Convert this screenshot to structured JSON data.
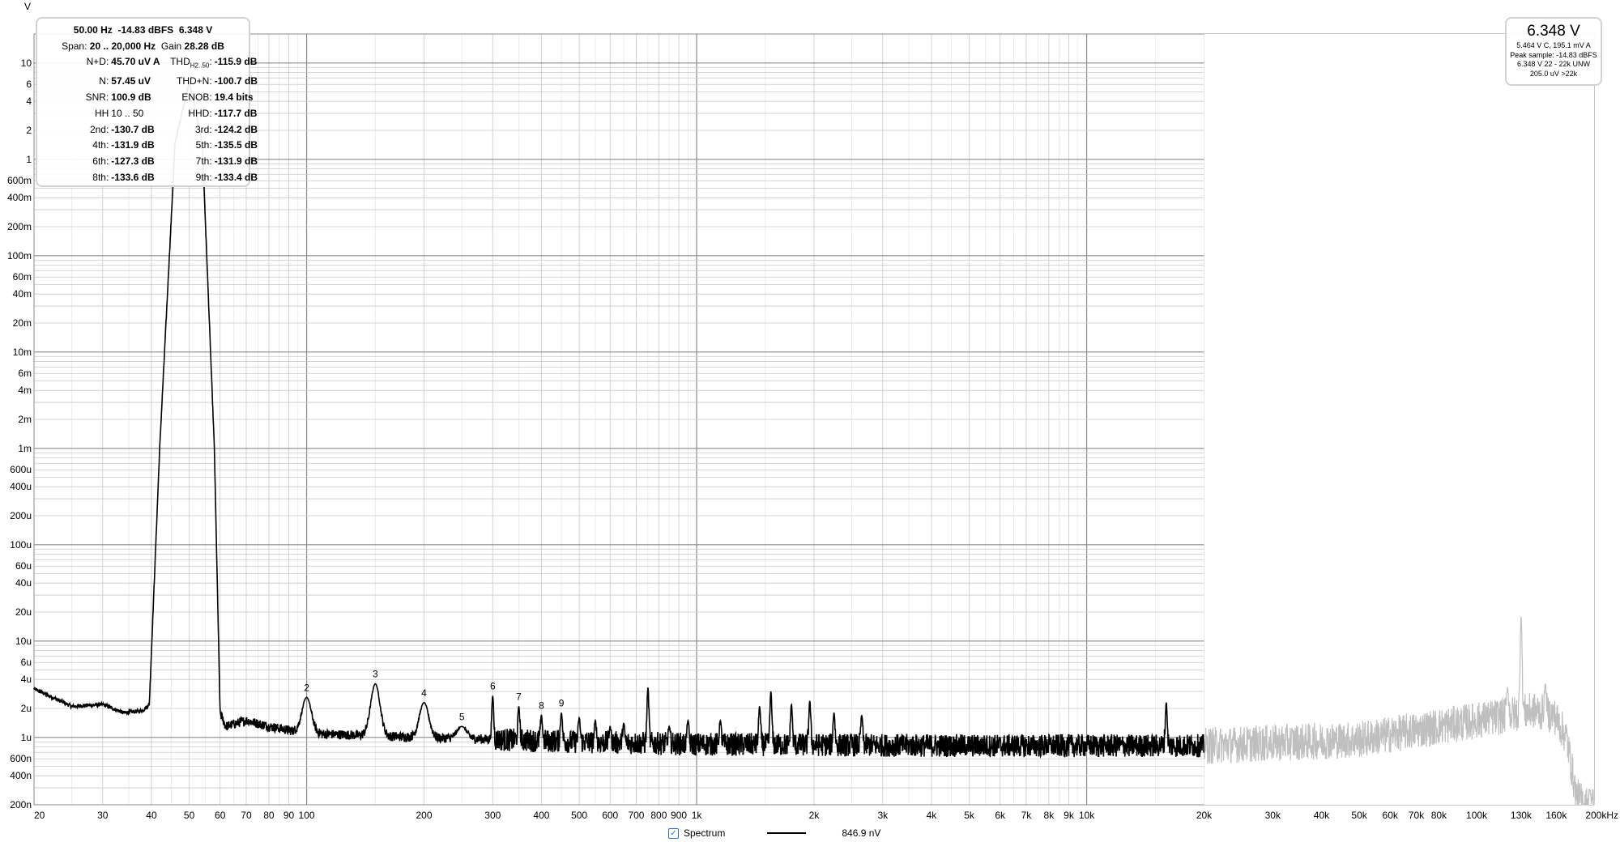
{
  "stats": {
    "header1": {
      "freq": "50.00 Hz",
      "dbfs": "-14.83 dBFS",
      "volts": "6.348 V"
    },
    "header2": {
      "span_label": "Span:",
      "span": "20 .. 20,000 Hz",
      "gain_label": "Gain",
      "gain": "28.28 dB"
    },
    "rows": [
      {
        "l1": "N+D:",
        "v1": "45.70 uV A",
        "l2": "THD",
        "l2sub": "H2..50",
        "l2end": ":",
        "v2": "-115.9 dB"
      },
      {
        "l1": "N:",
        "v1": "57.45 uV",
        "l2": "THD+N:",
        "v2": "-100.7 dB"
      },
      {
        "l1": "SNR:",
        "v1": "100.9 dB",
        "l2": "ENOB:",
        "v2": "19.4 bits"
      },
      {
        "l1": "HH",
        "v1": "10 .. 50",
        "l2": "HHD:",
        "v2": "-117.7 dB",
        "plain1": true
      },
      {
        "l1": "2nd:",
        "v1": "-130.7 dB",
        "l2": "3rd:",
        "v2": "-124.2 dB"
      },
      {
        "l1": "4th:",
        "v1": "-131.9 dB",
        "l2": "5th:",
        "v2": "-135.5 dB"
      },
      {
        "l1": "6th:",
        "v1": "-127.3 dB",
        "l2": "7th:",
        "v2": "-131.9 dB"
      },
      {
        "l1": "8th:",
        "v1": "-133.6 dB",
        "l2": "9th:",
        "v2": "-133.4 dB"
      }
    ]
  },
  "level": {
    "main": "6.348 V",
    "lines": [
      "5.464 V C, 195.1 mV A",
      "Peak sample: -14.83 dBFS",
      "6.348 V 22 - 22k UNW",
      "205.0 uV >22k"
    ]
  },
  "legend": {
    "series_label": "Spectrum",
    "readout": "846.9 nV",
    "checked": "✓"
  },
  "chart_data": {
    "type": "line",
    "x_scale": "log",
    "y_scale": "log",
    "xlim": [
      20,
      200000
    ],
    "ylim": [
      2e-07,
      20
    ],
    "y_unit_label": "V",
    "x_unit_label": "Hz",
    "grid": true,
    "legend_position": "bottom-center",
    "analysis_band_hz": [
      20,
      20000
    ],
    "x_tick_labels": [
      {
        "v": 20,
        "t": "20"
      },
      {
        "v": 30,
        "t": "30"
      },
      {
        "v": 40,
        "t": "40"
      },
      {
        "v": 50,
        "t": "50"
      },
      {
        "v": 60,
        "t": "60"
      },
      {
        "v": 70,
        "t": "70"
      },
      {
        "v": 80,
        "t": "80"
      },
      {
        "v": 90,
        "t": "90"
      },
      {
        "v": 100,
        "t": "100"
      },
      {
        "v": 200,
        "t": "200"
      },
      {
        "v": 300,
        "t": "300"
      },
      {
        "v": 400,
        "t": "400"
      },
      {
        "v": 500,
        "t": "500"
      },
      {
        "v": 600,
        "t": "600"
      },
      {
        "v": 700,
        "t": "700"
      },
      {
        "v": 800,
        "t": "800"
      },
      {
        "v": 900,
        "t": "900"
      },
      {
        "v": 1000,
        "t": "1k"
      },
      {
        "v": 2000,
        "t": "2k"
      },
      {
        "v": 3000,
        "t": "3k"
      },
      {
        "v": 4000,
        "t": "4k"
      },
      {
        "v": 5000,
        "t": "5k"
      },
      {
        "v": 6000,
        "t": "6k"
      },
      {
        "v": 7000,
        "t": "7k"
      },
      {
        "v": 8000,
        "t": "8k"
      },
      {
        "v": 9000,
        "t": "9k"
      },
      {
        "v": 10000,
        "t": "10k"
      },
      {
        "v": 20000,
        "t": "20k"
      },
      {
        "v": 30000,
        "t": "30k"
      },
      {
        "v": 40000,
        "t": "40k"
      },
      {
        "v": 50000,
        "t": "50k"
      },
      {
        "v": 60000,
        "t": "60k"
      },
      {
        "v": 70000,
        "t": "70k"
      },
      {
        "v": 80000,
        "t": "80k"
      },
      {
        "v": 100000,
        "t": "100k"
      },
      {
        "v": 130000,
        "t": "130k"
      },
      {
        "v": 160000,
        "t": "160k"
      },
      {
        "v": 200000,
        "t": "200kHz"
      }
    ],
    "y_tick_labels": [
      {
        "v": 10,
        "t": "10"
      },
      {
        "v": 6,
        "t": "6"
      },
      {
        "v": 4,
        "t": "4"
      },
      {
        "v": 2,
        "t": "2"
      },
      {
        "v": 1,
        "t": "1"
      },
      {
        "v": 0.6,
        "t": "600m"
      },
      {
        "v": 0.4,
        "t": "400m"
      },
      {
        "v": 0.2,
        "t": "200m"
      },
      {
        "v": 0.1,
        "t": "100m"
      },
      {
        "v": 0.06,
        "t": "60m"
      },
      {
        "v": 0.04,
        "t": "40m"
      },
      {
        "v": 0.02,
        "t": "20m"
      },
      {
        "v": 0.01,
        "t": "10m"
      },
      {
        "v": 0.006,
        "t": "6m"
      },
      {
        "v": 0.004,
        "t": "4m"
      },
      {
        "v": 0.002,
        "t": "2m"
      },
      {
        "v": 0.001,
        "t": "1m"
      },
      {
        "v": 0.0006,
        "t": "600u"
      },
      {
        "v": 0.0004,
        "t": "400u"
      },
      {
        "v": 0.0002,
        "t": "200u"
      },
      {
        "v": 0.0001,
        "t": "100u"
      },
      {
        "v": 6e-05,
        "t": "60u"
      },
      {
        "v": 4e-05,
        "t": "40u"
      },
      {
        "v": 2e-05,
        "t": "20u"
      },
      {
        "v": 1e-05,
        "t": "10u"
      },
      {
        "v": 6e-06,
        "t": "6u"
      },
      {
        "v": 4e-06,
        "t": "4u"
      },
      {
        "v": 2e-06,
        "t": "2u"
      },
      {
        "v": 1e-06,
        "t": "1u"
      },
      {
        "v": 6e-07,
        "t": "600n"
      },
      {
        "v": 4e-07,
        "t": "400n"
      },
      {
        "v": 2e-07,
        "t": "200n"
      }
    ],
    "series": [
      {
        "name": "Spectrum",
        "color": "#000000",
        "outside_band_color": "#bfbfbf",
        "baseline_profile": [
          [
            20,
            3.2e-06
          ],
          [
            25,
            2.1e-06
          ],
          [
            30,
            2.2e-06
          ],
          [
            34,
            1.8e-06
          ],
          [
            38,
            1.9e-06
          ],
          [
            39.5,
            2.2e-06
          ],
          [
            42,
            0.001
          ],
          [
            46,
            1.5
          ],
          [
            50,
            6.348
          ],
          [
            54,
            1.5
          ],
          [
            58,
            0.001
          ],
          [
            60,
            1.8e-06
          ],
          [
            62,
            1.3e-06
          ],
          [
            70,
            1.5e-06
          ],
          [
            80,
            1.3e-06
          ],
          [
            100,
            1.1e-06
          ],
          [
            200,
            1e-06
          ],
          [
            500,
            9e-07
          ],
          [
            1000,
            8.5e-07
          ],
          [
            5000,
            8.2e-07
          ],
          [
            20000,
            8.2e-07
          ],
          [
            50000,
            9.5e-07
          ],
          [
            100000,
            1.5e-06
          ],
          [
            140000,
            1.9e-06
          ],
          [
            158000,
            1.7e-06
          ],
          [
            170000,
            1e-06
          ],
          [
            180000,
            2.5e-07
          ],
          [
            190000,
            2e-07
          ]
        ],
        "peaks": [
          [
            100,
            2.6e-06
          ],
          [
            150,
            3.6e-06
          ],
          [
            200,
            2.3e-06
          ],
          [
            250,
            1.3e-06
          ],
          [
            300,
            2.7e-06
          ],
          [
            350,
            2.1e-06
          ],
          [
            400,
            1.7e-06
          ],
          [
            450,
            1.8e-06
          ],
          [
            500,
            1.6e-06
          ],
          [
            550,
            1.5e-06
          ],
          [
            600,
            1.3e-06
          ],
          [
            650,
            1.4e-06
          ],
          [
            750,
            3.3e-06
          ],
          [
            850,
            1.3e-06
          ],
          [
            950,
            1.5e-06
          ],
          [
            1150,
            1.5e-06
          ],
          [
            1450,
            2.1e-06
          ],
          [
            1550,
            3e-06
          ],
          [
            1750,
            2.2e-06
          ],
          [
            1950,
            2.4e-06
          ],
          [
            2250,
            1.8e-06
          ],
          [
            2650,
            1.7e-06
          ],
          [
            16000,
            2.3e-06
          ],
          [
            120000,
            3.3e-06
          ],
          [
            130000,
            1.8e-05
          ],
          [
            150000,
            3.6e-06
          ],
          [
            195000,
            2.9e-07
          ]
        ],
        "noise_spread_decades": 0.12
      }
    ],
    "harmonic_markers": [
      {
        "label": "2",
        "x": 100,
        "y": 2.6e-06
      },
      {
        "label": "3",
        "x": 150,
        "y": 3.6e-06
      },
      {
        "label": "4",
        "x": 200,
        "y": 2.3e-06
      },
      {
        "label": "5",
        "x": 250,
        "y": 1.3e-06
      },
      {
        "label": "6",
        "x": 300,
        "y": 2.7e-06
      },
      {
        "label": "7",
        "x": 350,
        "y": 2.1e-06
      },
      {
        "label": "8",
        "x": 400,
        "y": 1.7e-06
      },
      {
        "label": "9",
        "x": 450,
        "y": 1.8e-06
      }
    ]
  }
}
